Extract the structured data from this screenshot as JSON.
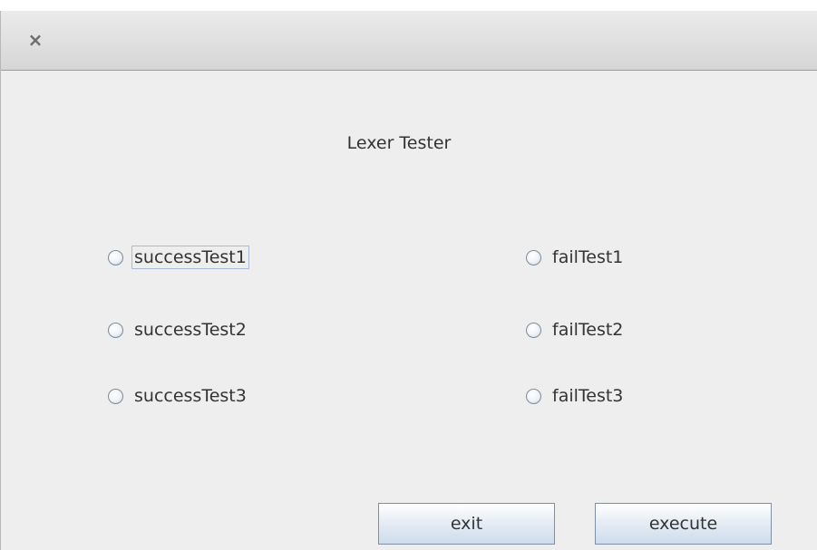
{
  "window": {
    "close_glyph": "×"
  },
  "heading": "Lexer Tester",
  "radios": {
    "success1": "successTest1",
    "success2": "successTest2",
    "success3": "successTest3",
    "fail1": "failTest1",
    "fail2": "failTest2",
    "fail3": "failTest3"
  },
  "buttons": {
    "exit": "exit",
    "execute": "execute"
  },
  "colors": {
    "window_bg": "#eeeeee",
    "titlebar": "#d9d9d9",
    "text": "#333333",
    "button_border": "#7f8fa4",
    "focus_border": "#a7bdd6"
  }
}
